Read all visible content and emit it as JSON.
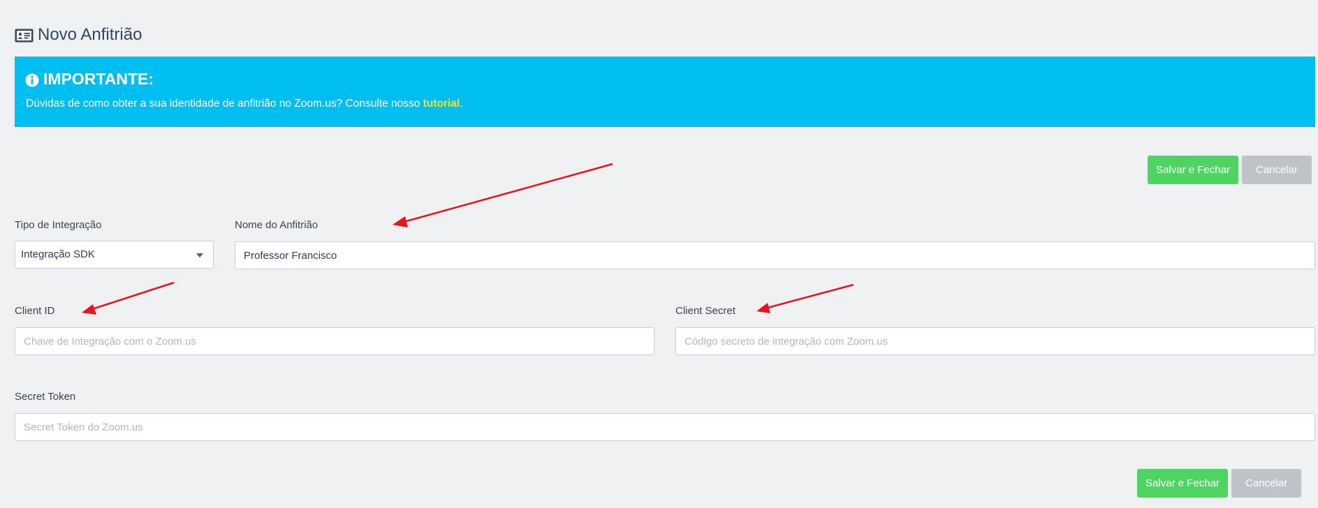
{
  "header": {
    "title": "Novo Anfitrião",
    "icon": "id-card-icon"
  },
  "alert": {
    "heading": "IMPORTANTE:",
    "text": "Dúvidas de como obter a sua identidade de anfitrião no Zoom.us? Consulte nosso ",
    "link_text": "tutorial",
    "trailing": ".",
    "background": "#00bef0",
    "link_color": "#f4e22a"
  },
  "actions_top": {
    "save_label": "Salvar e Fechar",
    "cancel_label": "Cancelar"
  },
  "form": {
    "integration_type": {
      "label": "Tipo de Integração",
      "value": "Integração SDK"
    },
    "host_name": {
      "label": "Nome do Anfitrião",
      "value": "Professor Francisco"
    },
    "client_id": {
      "label": "Client ID",
      "value": "",
      "placeholder": "Chave de Integração com o Zoom.us"
    },
    "client_secret": {
      "label": "Client Secret",
      "value": "",
      "placeholder": "Código secreto de integração com Zoom.us"
    },
    "secret_token": {
      "label": "Secret Token",
      "value": "",
      "placeholder": "Secret Token do Zoom.us"
    }
  },
  "actions_bottom": {
    "save_label": "Salvar e Fechar",
    "cancel_label": "Cancelar"
  },
  "colors": {
    "save": "#4ed462",
    "cancel": "#bdc3c7",
    "annotation_arrow": "#e8141b"
  }
}
